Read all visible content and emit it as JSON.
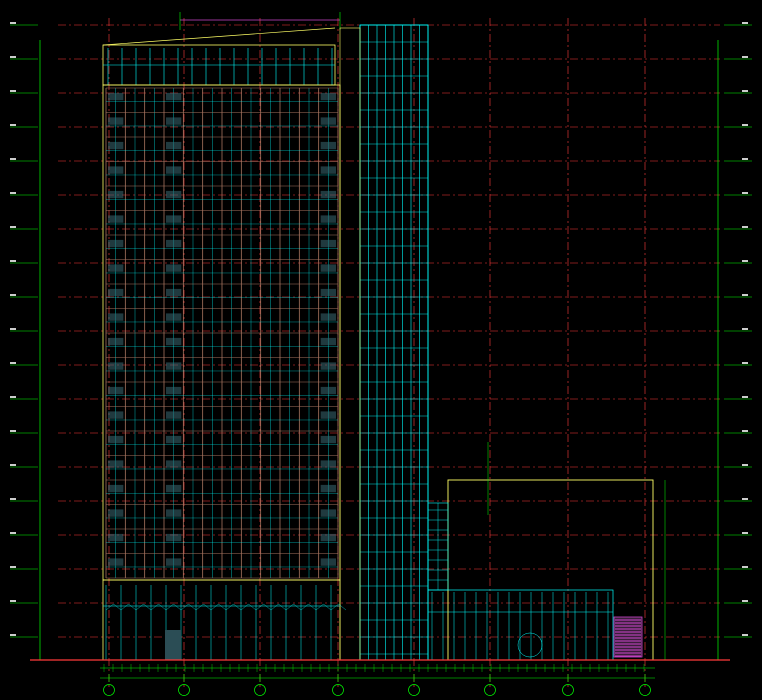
{
  "drawing": {
    "background": "#000000",
    "colors": {
      "tower_grid": "#a87560",
      "glass_frame": "#00ffff",
      "outline": "#ffff66",
      "dimension": "#00ff00",
      "axis_grid": "#ff3b3b",
      "stair": "#cc44cc",
      "annotation": "#ffffff"
    },
    "roof_annotation": "",
    "podium_annotation": "",
    "ground_annotation": "",
    "left_annotation": "",
    "axis_labels": [
      "",
      "",
      "",
      "",
      "",
      "",
      ""
    ],
    "tower_floors": 20,
    "tower_bays": 12
  }
}
